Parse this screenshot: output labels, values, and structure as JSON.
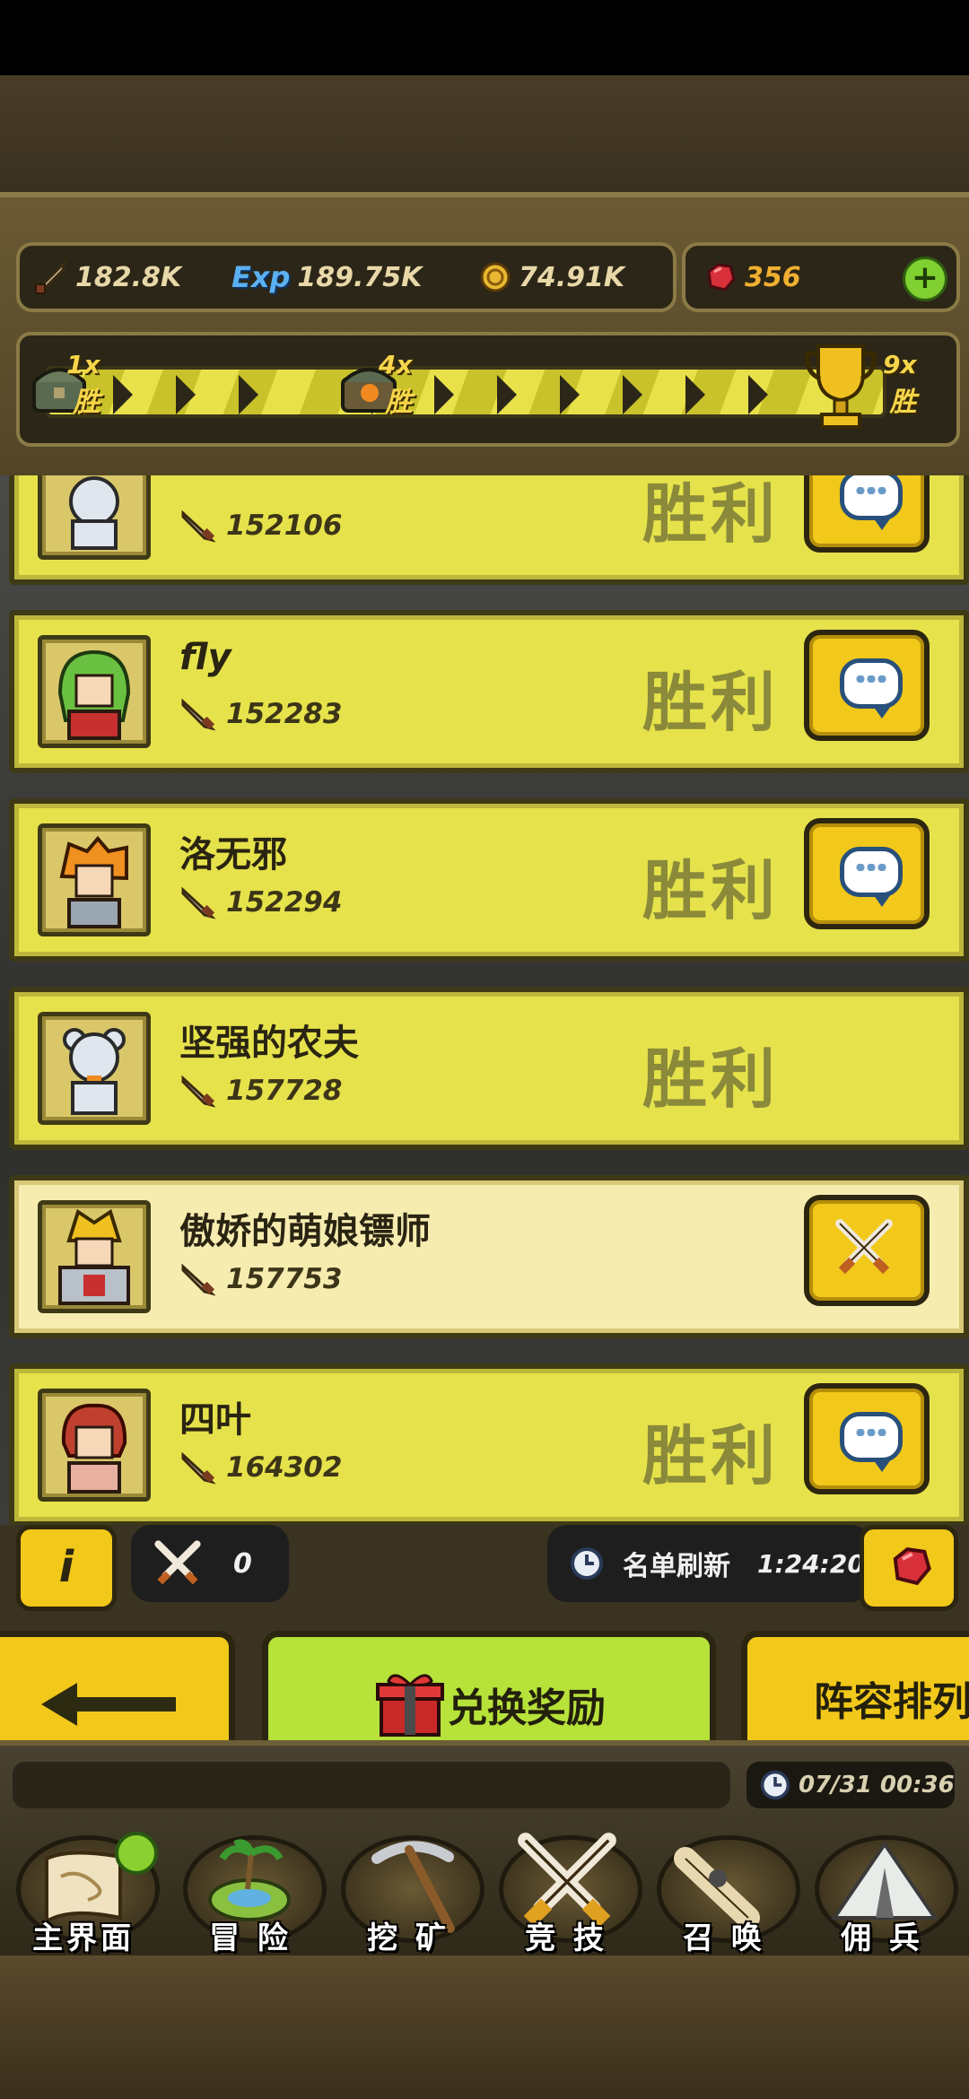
{
  "resources": {
    "power": "182.8K",
    "exp_label": "Exp",
    "exp": "189.75K",
    "coins": "74.91K",
    "gems": "356"
  },
  "progress": {
    "milestones": [
      {
        "mult": "1x",
        "label": "胜"
      },
      {
        "mult": "4x",
        "label": "胜"
      },
      {
        "mult": "9x",
        "label": "胜"
      }
    ]
  },
  "opponents": [
    {
      "name": "",
      "power": "152106",
      "result": "胜利",
      "action": "chat-icon"
    },
    {
      "name": "fly",
      "power": "152283",
      "result": "胜利",
      "action": "chat-icon"
    },
    {
      "name": "洛无邪",
      "power": "152294",
      "result": "胜利",
      "action": "chat-icon"
    },
    {
      "name": "坚强的农夫",
      "power": "157728",
      "result": "胜利",
      "action": ""
    },
    {
      "name": "傲娇的萌娘镖师",
      "power": "157753",
      "result": "",
      "action": "crossed-swords-icon"
    },
    {
      "name": "四叶",
      "power": "164302",
      "result": "胜利",
      "action": "chat-icon"
    }
  ],
  "arena_bar": {
    "info_label": "i",
    "attempts": "0",
    "refresh_label": "名单刷新",
    "refresh_timer": "1:24:20"
  },
  "buttons": {
    "exchange": "兑换奖励",
    "lineup": "阵容排列"
  },
  "clock": "07/31 00:36",
  "nav": [
    {
      "label": "主界面"
    },
    {
      "label": "冒 险"
    },
    {
      "label": "挖 矿"
    },
    {
      "label": "竞 技"
    },
    {
      "label": "召 唤"
    },
    {
      "label": "佣 兵"
    }
  ],
  "colors": {
    "row_yellow": "#e6e24b",
    "row_highlight": "#f7ecb0",
    "win_text": "#8a8a3a",
    "button_gold": "#f2c81a",
    "gem_red": "#d8303a",
    "exchange_green": "#b6e23a"
  }
}
